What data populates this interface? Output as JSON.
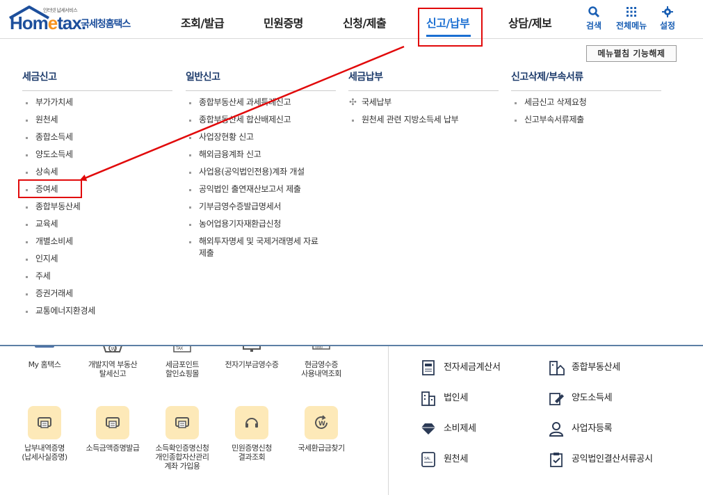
{
  "logo": {
    "tagline": "인터넷 납세서비스",
    "name_prefix": "Hom",
    "name_e": "e",
    "name_suffix": "tax.",
    "korean_name": "국세청홈택스"
  },
  "nav": {
    "items": [
      "조회/발급",
      "민원증명",
      "신청/제출",
      "신고/납부",
      "상담/제보"
    ],
    "active_index": 3
  },
  "utility": {
    "search": "검색",
    "all_menu": "전체메뉴",
    "settings": "설정"
  },
  "menu_panel": {
    "toggle_label": "메뉴펼침 기능해제",
    "columns": [
      {
        "title": "세금신고",
        "items": [
          "부가가치세",
          "원천세",
          "종합소득세",
          "양도소득세",
          "상속세",
          "증여세",
          "종합부동산세",
          "교육세",
          "개별소비세",
          "인지세",
          "주세",
          "증권거래세",
          "교통에너지환경세"
        ]
      },
      {
        "title": "일반신고",
        "items": [
          "종합부동산세 과세특례신고",
          "종합부동산세 합산배제신고",
          "사업장현황 신고",
          "해외금융계좌 신고",
          "사업용(공익법인전용)계좌 개설",
          "공익법인 출연재산보고서 제출",
          "기부금영수증발급명세서",
          "농어업용기자재환급신청",
          "해외투자명세 및 국제거래명세 자료\n제출"
        ]
      },
      {
        "title": "세금납부",
        "items": [
          "국세납부",
          "원천세 관련 지방소득세 납부"
        ]
      },
      {
        "title": "신고삭제/부속서류",
        "items": [
          "세금신고 삭제요청",
          "신고부속서류제출"
        ]
      }
    ]
  },
  "quick_tiles_row1": [
    "My 홈택스",
    "개발지역 부동산\n탈세신고",
    "세금포인트\n할인쇼핑몰",
    "전자기부금영수증",
    "현금영수증\n사용내역조회"
  ],
  "quick_tiles_row2": [
    "납부내역증명\n(납세사실증명)",
    "소득금액증명발급",
    "소득확인증명신청\n개인종합자산관리\n계좌 가입용",
    "민원증명신청\n결과조회",
    "국세환급금찾기"
  ],
  "tax_services": {
    "left": [
      "전자세금계산서",
      "법인세",
      "소비제세",
      "원천세"
    ],
    "right": [
      "종합부동산세",
      "양도소득세",
      "사업자등록",
      "공익법인결산서류공시"
    ]
  },
  "colors": {
    "brand_blue": "#1d4f9c",
    "active_blue": "#1b6fd2",
    "annotation_red": "#e1090a",
    "tile_yellow": "#fde9b8"
  }
}
